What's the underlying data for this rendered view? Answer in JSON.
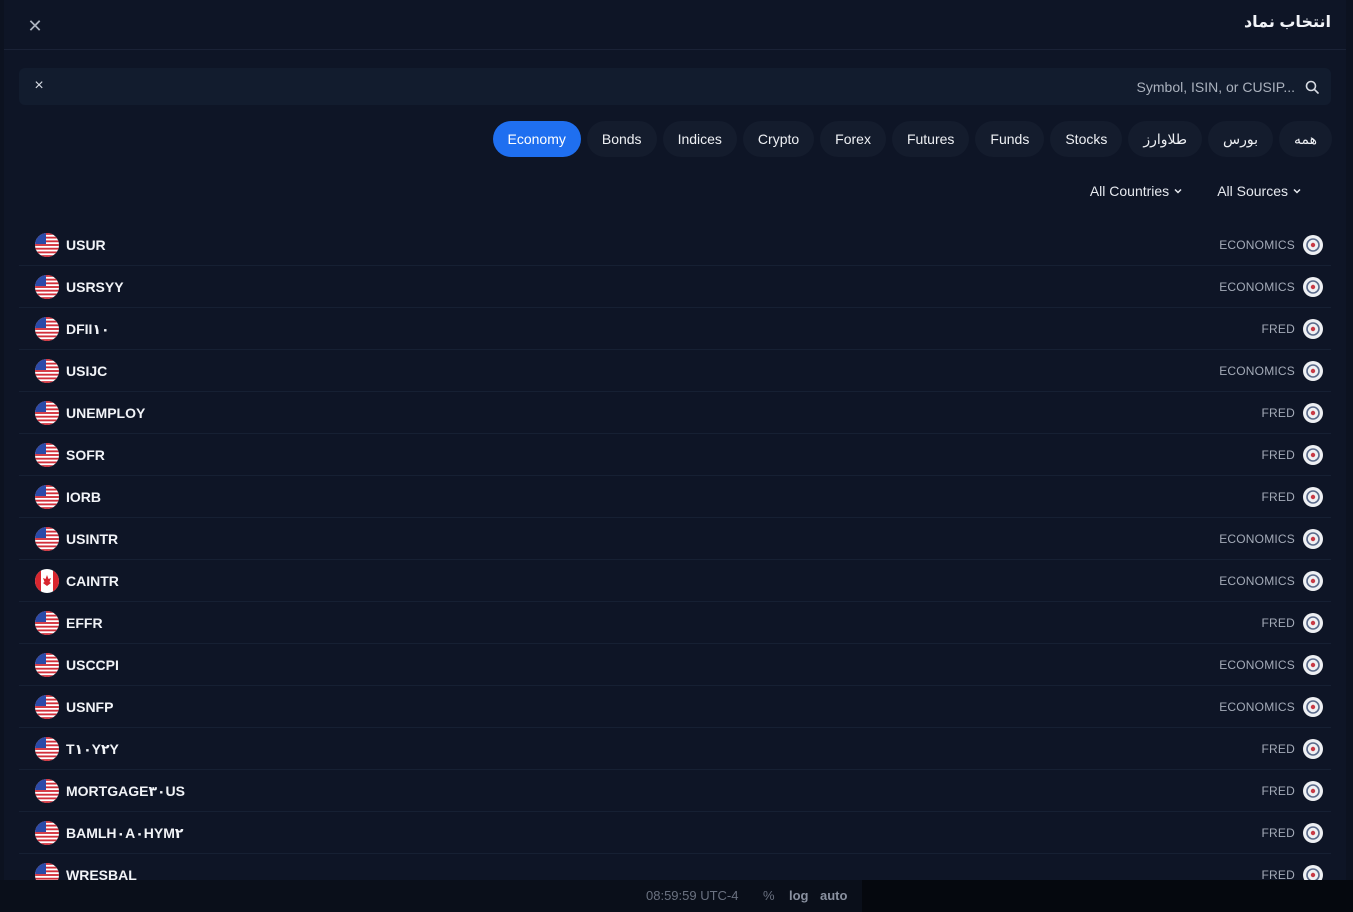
{
  "dialog": {
    "title": "انتخاب نماد",
    "close_icon": "close-icon"
  },
  "search": {
    "value": "",
    "placeholder": "Symbol, ISIN, or CUSIP..."
  },
  "tabs": [
    {
      "label": "همه"
    },
    {
      "label": "بورس"
    },
    {
      "label": "طلاوارز"
    },
    {
      "label": "Stocks"
    },
    {
      "label": "Funds"
    },
    {
      "label": "Futures"
    },
    {
      "label": "Forex"
    },
    {
      "label": "Crypto"
    },
    {
      "label": "Indices"
    },
    {
      "label": "Bonds"
    },
    {
      "label": "Economy",
      "active": true
    }
  ],
  "filters": {
    "sources": "All Sources",
    "countries": "All Countries"
  },
  "rows": [
    {
      "symbol": "USUR",
      "source": "ECONOMICS",
      "country": "us"
    },
    {
      "symbol": "USRSYY",
      "source": "ECONOMICS",
      "country": "us"
    },
    {
      "symbol": "DFII۱۰",
      "source": "FRED",
      "country": "us"
    },
    {
      "symbol": "USIJC",
      "source": "ECONOMICS",
      "country": "us"
    },
    {
      "symbol": "UNEMPLOY",
      "source": "FRED",
      "country": "us"
    },
    {
      "symbol": "SOFR",
      "source": "FRED",
      "country": "us"
    },
    {
      "symbol": "IORB",
      "source": "FRED",
      "country": "us"
    },
    {
      "symbol": "USINTR",
      "source": "ECONOMICS",
      "country": "us"
    },
    {
      "symbol": "CAINTR",
      "source": "ECONOMICS",
      "country": "ca"
    },
    {
      "symbol": "EFFR",
      "source": "FRED",
      "country": "us"
    },
    {
      "symbol": "USCCPI",
      "source": "ECONOMICS",
      "country": "us"
    },
    {
      "symbol": "USNFP",
      "source": "ECONOMICS",
      "country": "us"
    },
    {
      "symbol": "T۱۰Y۲Y",
      "source": "FRED",
      "country": "us"
    },
    {
      "symbol": "MORTGAGE۳۰US",
      "source": "FRED",
      "country": "us"
    },
    {
      "symbol": "BAMLH۰A۰HYM۲",
      "source": "FRED",
      "country": "us"
    },
    {
      "symbol": "WRESBAL",
      "source": "FRED",
      "country": "us"
    }
  ],
  "statusbar": {
    "time": "08:59:59 UTC-4",
    "percent": "%",
    "log": "log",
    "auto": "auto"
  },
  "colors": {
    "accent": "#1f6ff0",
    "background": "#0e1526"
  }
}
